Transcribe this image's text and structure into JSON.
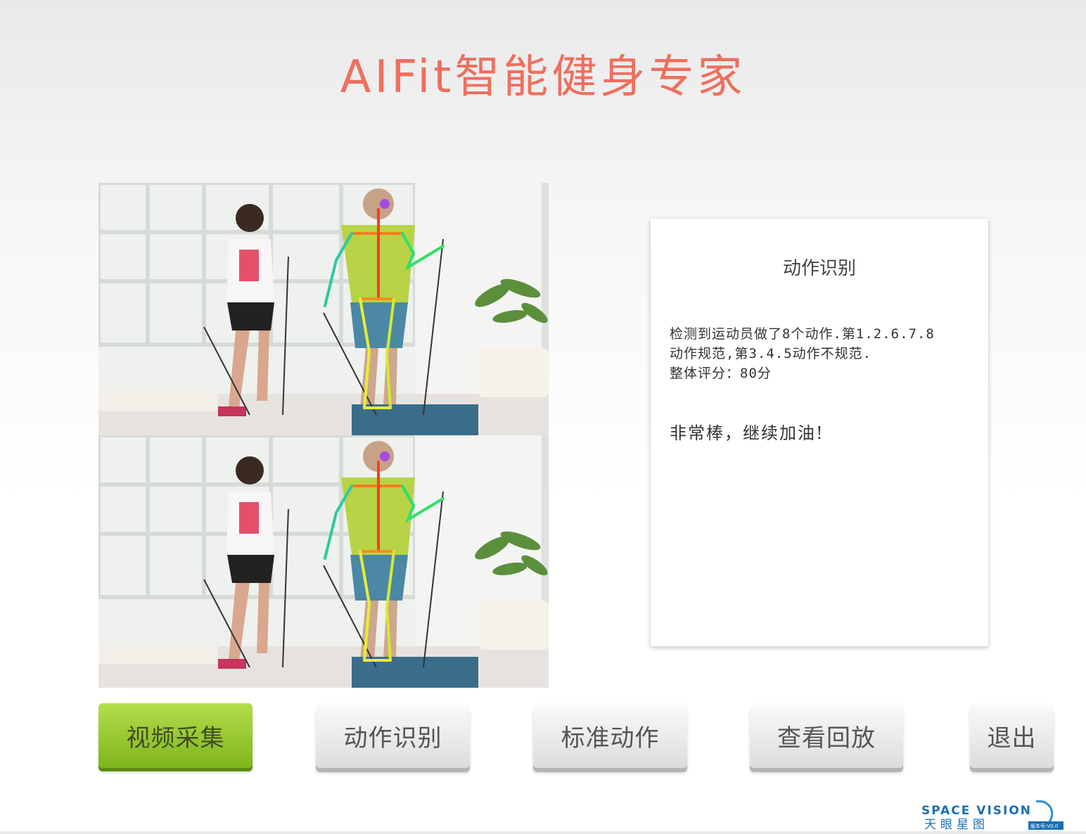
{
  "app": {
    "title": "AIFit智能健身专家"
  },
  "panel": {
    "title": "动作识别",
    "lines": [
      "检测到运动员做了8个动作.第1.2.6.7.8",
      "动作规范,第3.4.5动作不规范.",
      "整体评分：80分"
    ],
    "encouragement": "非常棒，继续加油!"
  },
  "buttons": {
    "capture": "视频采集",
    "recognize": "动作识别",
    "standard": "标准动作",
    "playback": "查看回放",
    "exit": "退出"
  },
  "logo": {
    "en": "SPACE VISION",
    "cn": "天眼星图",
    "version": "版本号:V0.0"
  },
  "colors": {
    "title": "#ee6f5f",
    "active_button": "#8fc22a",
    "skeleton_torso": "#ff3b1f",
    "skeleton_arm": "#2ee06a",
    "skeleton_leg": "#e7ee35"
  }
}
